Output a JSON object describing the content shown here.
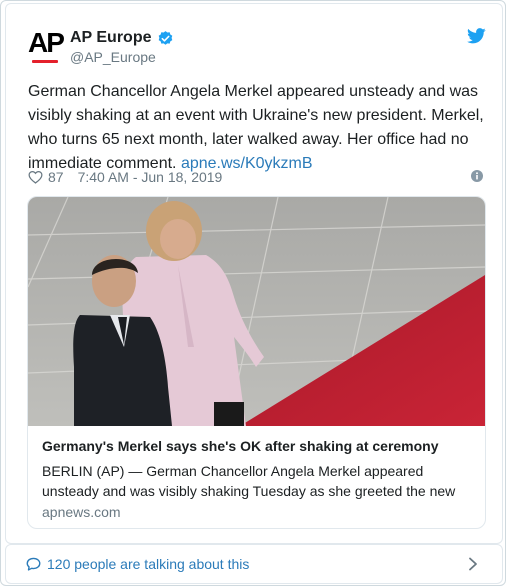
{
  "account": {
    "name": "AP Europe",
    "handle": "@AP_Europe",
    "logo_text": "AP"
  },
  "tweet": {
    "text": "German Chancellor Angela Merkel appeared unsteady and was visibly shaking at an event with Ukraine's new president. Merkel, who turns 65 next month, later walked away. Her office had no immediate comment. ",
    "link": "apne.ws/K0ykzmB",
    "likes": "87",
    "timestamp": "7:40 AM - Jun 18, 2019"
  },
  "link_card": {
    "title": "Germany's Merkel says she's OK after shaking at ceremony",
    "description": "BERLIN (AP) — German Chancellor Angela Merkel appeared unsteady and was visibly shaking Tuesday as she greeted the new",
    "domain": "apnews.com"
  },
  "footer": {
    "talking_text": "120 people are talking about this"
  },
  "icons": {
    "verified": "verified-badge-icon",
    "bird": "twitter-bird-icon",
    "heart": "heart-icon",
    "info": "info-icon",
    "comment": "comment-bubble-icon",
    "chevron": "chevron-right-icon"
  },
  "colors": {
    "link": "#2b7bb9",
    "verified": "#1da1f2",
    "twitter_blue": "#1da1f2",
    "muted": "#697882",
    "ap_red": "#e4202b",
    "carpet_red": "#b81d2b"
  }
}
